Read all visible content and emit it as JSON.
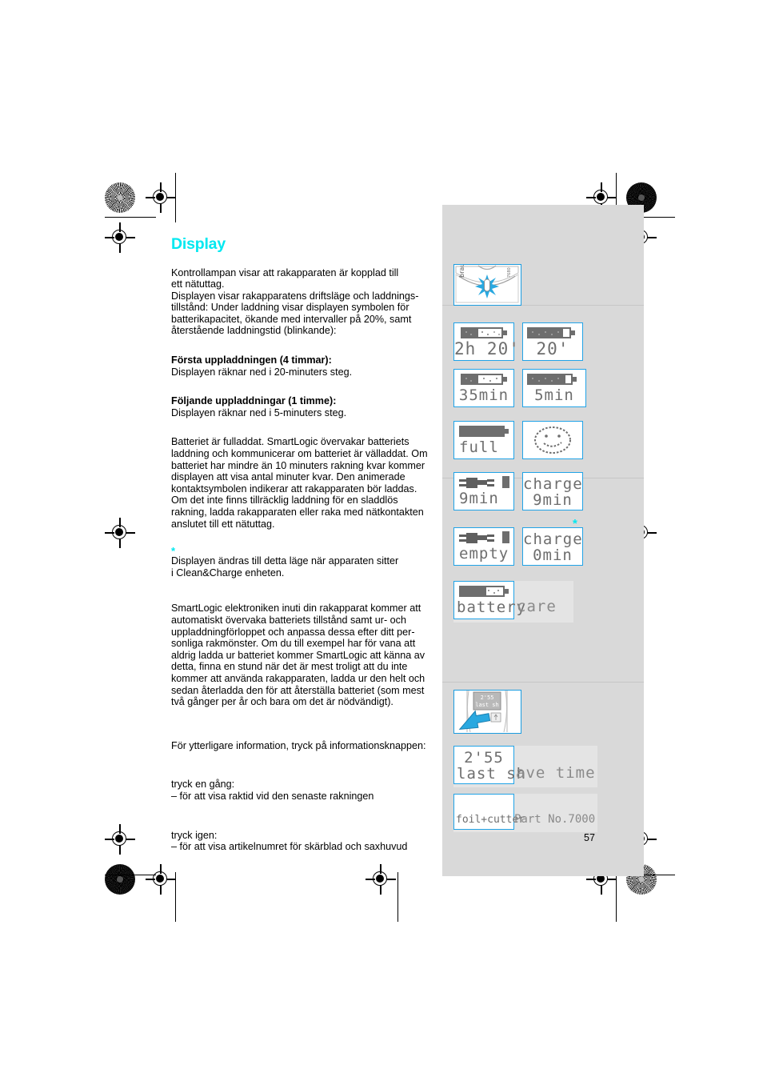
{
  "document": {
    "page_number": "57",
    "heading": "Display",
    "heading_color": "#00e8f0",
    "accent_color": "#21a3e7",
    "panel_color": "#d9d9d9",
    "language": "sv"
  },
  "body_text": {
    "intro": "Kontrollampan visar att rakapparaten är kopplad till ett nätuttag.\nDisplayen visar rakapparatens driftsläge och laddnings-tillstånd: Under laddning visar displayen symbolen för batterikapacitet, ökande med intervaller på 20%, samt återstående laddningstid (blinkande):",
    "intro_lines": [
      "Kontrollampan visar att rakapparaten är kopplad till",
      "ett nätuttag.",
      "Displayen visar rakapparatens driftsläge och laddnings-",
      "tillstånd: Under laddning visar displayen symbolen för",
      "batterikapacitet, ökande med intervaller på 20%, samt",
      "återstående laddningstid (blinkande):"
    ],
    "first_charge_heading": "Första uppladdningen (4 timmar):",
    "first_charge_text": "Displayen räknar ned i 20-minuters steg.",
    "next_charge_heading": "Följande uppladdningar (1 timme):",
    "next_charge_text": "Displayen räknar ned i 5-minuters steg.",
    "full_battery_lines": [
      "Batteriet är fulladdat. SmartLogic övervakar batteriets",
      "laddning och kommunicerar om batteriet är välladdat. Om",
      "batteriet har mindre än 10 minuters rakning kvar kommer",
      "displayen att visa antal minuter kvar. Den animerade",
      "kontaktsymbolen indikerar att rakapparaten bör laddas.",
      "Om det inte finns tillräcklig laddning för en sladdlös",
      "rakning, ladda rakapparaten eller raka med nätkontakten",
      "anslutet till ett nätuttag."
    ],
    "footnote_marker": "*",
    "footnote_lines": [
      "Displayen ändras till detta läge när apparaten sitter",
      "i Clean&Charge enheten."
    ],
    "smartlogic_lines": [
      "SmartLogic elektroniken inuti din rakapparat kommer att",
      "automatiskt övervaka batteriets tillstånd samt ur- och",
      "uppladdningförloppet och anpassa dessa efter ditt per-",
      "sonliga rakmönster. Om du till exempel har för vana att",
      "aldrig ladda ur batteriet kommer SmartLogic att känna av",
      "detta, finna en stund när det är mest troligt att du inte",
      "kommer att använda rakapparaten, ladda ur den helt och",
      "sedan återladda den för att återställa batteriet (som mest",
      "två gånger per år och bara om det är nödvändigt)."
    ],
    "more_info": "För ytterligare information, tryck på informationsknappen:",
    "press_once_heading": "tryck en gång:",
    "press_once_text": "– för att visa raktid vid den senaste rakningen",
    "press_again_heading": "tryck igen:",
    "press_again_text": "– för att visa artikelnumret för skärblad och saxhuvud"
  },
  "illustrations": {
    "shaver_led": {
      "name": "shaver-top-with-led-flash",
      "brand_label": "braun",
      "model_label": "7680"
    },
    "shaver_info_button": {
      "name": "shaver-display-info-button",
      "display_line1": "2'55",
      "display_line2": "last sh"
    }
  },
  "lcd_screens": [
    {
      "id": "charge-2h20",
      "icon": "battery-40",
      "battery_fill": 40,
      "text": "2h 20'",
      "font_size": 22
    },
    {
      "id": "charge-20",
      "icon": "battery-80",
      "battery_fill": 80,
      "text": "20'",
      "font_size": 22
    },
    {
      "id": "charge-35min",
      "icon": "battery-40",
      "battery_fill": 40,
      "text": "35min",
      "font_size": 20
    },
    {
      "id": "charge-5min",
      "icon": "battery-80",
      "battery_fill": 80,
      "text": "5min",
      "font_size": 20
    },
    {
      "id": "full",
      "icon": "battery-100",
      "battery_fill": 100,
      "text": "full",
      "font_size": 20
    },
    {
      "id": "smiley",
      "icon": "smiley-face",
      "battery_fill": 0,
      "text": "",
      "font_size": 20
    },
    {
      "id": "plug-9min",
      "icon": "plug-symbol",
      "battery_fill": 0,
      "text": "9min",
      "font_size": 20
    },
    {
      "id": "charge-9min",
      "icon": "none",
      "battery_fill": 0,
      "text": "charge",
      "text2": "9min",
      "font_size": 20
    },
    {
      "id": "plug-empty",
      "icon": "plug-symbol",
      "battery_fill": 0,
      "text": "empty",
      "font_size": 20
    },
    {
      "id": "charge-0min",
      "icon": "none",
      "battery_fill": 0,
      "text": "charge",
      "text2": "0min",
      "font_size": 20
    },
    {
      "id": "battery-care",
      "icon": "battery-60",
      "battery_fill": 60,
      "text": "battery care",
      "font_size": 20
    },
    {
      "id": "last-shave",
      "icon": "none",
      "battery_fill": 0,
      "text": "2'55",
      "text2": "last shave time",
      "font_size": 20
    },
    {
      "id": "part-number",
      "icon": "none",
      "battery_fill": 0,
      "text": "foil+cutter",
      "text2": "Part No.7000",
      "font_size": 16
    }
  ],
  "lcd_text": {
    "t_2h20": "2h 20'",
    "t_20": "20'",
    "t_35min": "35min",
    "t_5min": "5min",
    "t_full": "full",
    "t_9min": "9min",
    "t_charge": "charge",
    "t_charge9min": "9min",
    "t_empty": "empty",
    "t_charge2": "charge",
    "t_charge0min": "0min",
    "t_batterycare_in": "battery",
    "t_batterycare_out": "care",
    "t_lastshave_time": "2'55",
    "t_lastshave_in": "last sh",
    "t_lastshave_out": "ave time",
    "t_foilcutter": "foil+cutter",
    "t_partno": "Part No.7000",
    "footnote_star": "*"
  }
}
